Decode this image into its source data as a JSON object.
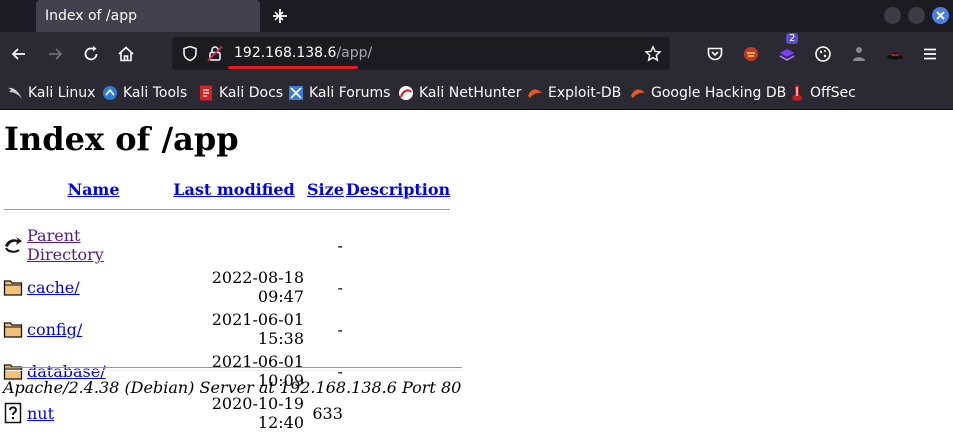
{
  "browser": {
    "tab_title": "Index of /app",
    "url_host": "192.168.138.6",
    "url_path": "/app/",
    "colors": {
      "chrome_dark": "#1c1b22",
      "chrome": "#2b2a33",
      "accent": "#4a7fe0",
      "underline": "#e01b24"
    },
    "bookmarks": [
      {
        "label": "Kali Linux",
        "icon": "kali-dragon-icon"
      },
      {
        "label": "Kali Tools",
        "icon": "kali-tools-icon"
      },
      {
        "label": "Kali Docs",
        "icon": "kali-docs-icon"
      },
      {
        "label": "Kali Forums",
        "icon": "kali-forums-icon"
      },
      {
        "label": "Kali NetHunter",
        "icon": "nethunter-icon"
      },
      {
        "label": "Exploit-DB",
        "icon": "exploit-db-icon"
      },
      {
        "label": "Google Hacking DB",
        "icon": "ghdb-icon"
      },
      {
        "label": "OffSec",
        "icon": "offsec-icon"
      }
    ],
    "extension_badge": "2"
  },
  "page": {
    "heading": "Index of /app",
    "columns": {
      "name": "Name",
      "modified": "Last modified",
      "size": "Size",
      "description": "Description"
    },
    "rows": [
      {
        "icon": "back-icon",
        "name": "Parent Directory",
        "modified": "",
        "size": "-",
        "visited": true
      },
      {
        "icon": "folder-icon",
        "name": "cache/",
        "modified": "2022-08-18 09:47",
        "size": "-",
        "visited": false
      },
      {
        "icon": "folder-icon",
        "name": "config/",
        "modified": "2021-06-01 15:38",
        "size": "-",
        "visited": false
      },
      {
        "icon": "folder-icon",
        "name": "database/",
        "modified": "2021-06-01 10:09",
        "size": "-",
        "visited": false
      },
      {
        "icon": "unknown-file-icon",
        "name": "nut",
        "modified": "2020-10-19 12:40",
        "size": "633",
        "visited": false
      }
    ],
    "footer": "Apache/2.4.38 (Debian) Server at 192.168.138.6 Port 80"
  }
}
